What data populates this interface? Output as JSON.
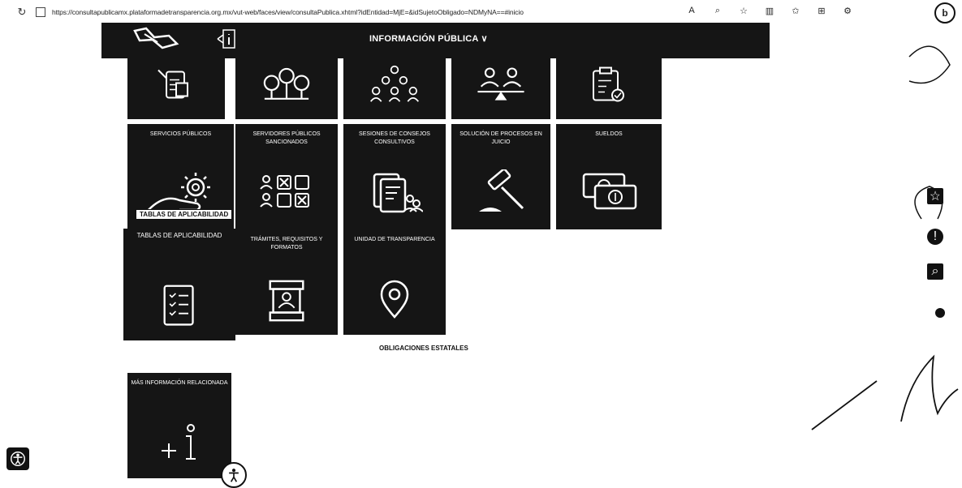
{
  "browser": {
    "url": "https://consultapublicamx.plataformadetransparencia.org.mx/vut-web/faces/view/consultaPublica.xhtml?idEntidad=MjE=&idSujetoObligado=NDMyNA==#inicio",
    "help_label": "b"
  },
  "header": {
    "menu_label": "INFORMACIÓN PÚBLICA"
  },
  "tiles": [
    {
      "label": ""
    },
    {
      "label": ""
    },
    {
      "label": ""
    },
    {
      "label": ""
    },
    {
      "label": ""
    },
    {
      "label": "SERVICIOS PÚBLICOS"
    },
    {
      "label": "SERVIDORES PÚBLICOS SANCIONADOS"
    },
    {
      "label": "SESIONES DE CONSEJOS CONSULTIVOS"
    },
    {
      "label": "SOLUCIÓN DE PROCESOS EN JUICIO"
    },
    {
      "label": "SUELDOS"
    },
    {
      "label": "TABLAS DE APLICABILIDAD"
    },
    {
      "label": "TRÁMITES, REQUISITOS Y FORMATOS"
    },
    {
      "label": "UNIDAD DE TRANSPARENCIA"
    },
    {
      "label": "MÁS INFORMACIÓN RELACIONADA"
    }
  ],
  "tooltip": {
    "label": "TABLAS DE APLICABILIDAD"
  },
  "sections": {
    "state_obligations": "OBLIGACIONES ESTATALES"
  },
  "colors": {
    "tile_bg": "#151515",
    "tile_fg": "#ffffff",
    "page_bg": "#ffffff"
  },
  "icons": [
    "refresh-icon",
    "lock-icon",
    "star-icon",
    "alert-icon",
    "search-icon",
    "accessibility-icon"
  ]
}
